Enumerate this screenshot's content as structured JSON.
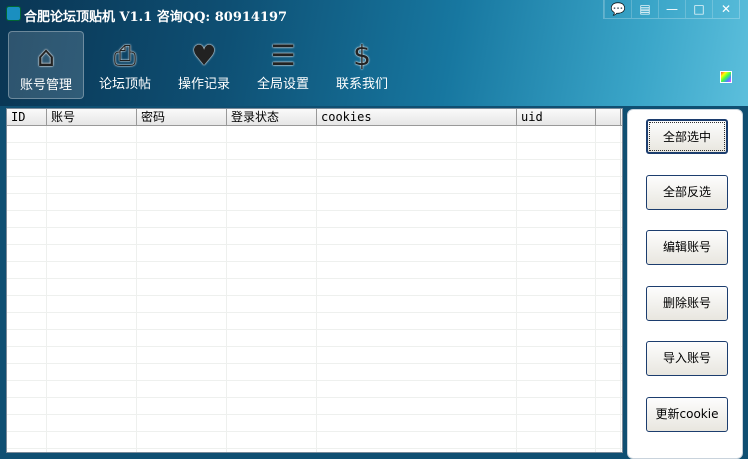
{
  "title": "合肥论坛顶贴机 V1.1 咨询QQ: 80914197",
  "window_controls": [
    "feedback",
    "menu",
    "minimize",
    "maximize",
    "close"
  ],
  "nav": [
    {
      "label": "账号管理",
      "icon": "home-icon",
      "glyph": "⌂"
    },
    {
      "label": "论坛顶帖",
      "icon": "printer-icon",
      "glyph": "⎙"
    },
    {
      "label": "操作记录",
      "icon": "heart-icon",
      "glyph": "♥"
    },
    {
      "label": "全局设置",
      "icon": "coins-icon",
      "glyph": "☰"
    },
    {
      "label": "联系我们",
      "icon": "dollar-icon",
      "glyph": "$"
    }
  ],
  "table": {
    "columns": [
      "ID",
      "账号",
      "密码",
      "登录状态",
      "cookies",
      "uid",
      ""
    ]
  },
  "buttons": [
    "全部选中",
    "全部反选",
    "编辑账号",
    "删除账号",
    "导入账号",
    "更新cookie"
  ]
}
